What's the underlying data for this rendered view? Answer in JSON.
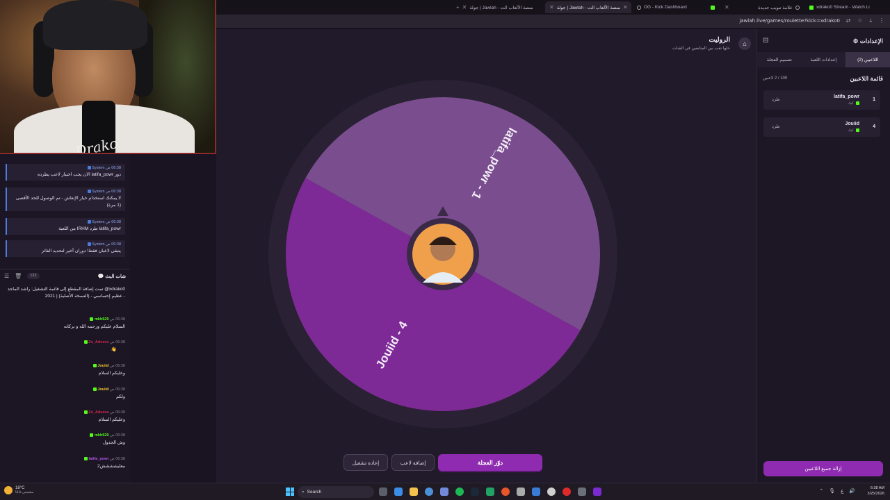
{
  "browser": {
    "tabs": [
      {
        "label": "xdrako0 Stream - Watch Li",
        "active": false
      },
      {
        "label": "علامة تبويب جديدة",
        "active": false
      },
      {
        "label": "OG - Kick Dashboard",
        "active": false
      },
      {
        "label": "جولة | Jawlah - منصة الألعاب الت",
        "active": true
      },
      {
        "label": "جولة | Jawlah - منصة الألعاب الت",
        "active": false
      }
    ],
    "url": "jawlah.live/games/roulette?kick=xdrako0"
  },
  "webcam": {
    "signature": "Drako"
  },
  "system_messages": [
    {
      "meta": "06:38 ص",
      "sender": "System",
      "text": "دور latifa_powr الان يجب اختيار لاعب يطرده"
    },
    {
      "meta": "06:38 ص",
      "sender": "System",
      "text": "لا يمكنك استخدام خيار الإنعاش - تم الوصول للحد الأقصى (1 مرة)"
    },
    {
      "meta": "06:38 ص",
      "sender": "System",
      "text": "latifa_powr طرد IRHM من اللعبة"
    },
    {
      "meta": "06:38 ص",
      "sender": "System",
      "text": "يتبقى لاعبان فقط! دوران أخير لتحديد الفائز"
    }
  ],
  "chat": {
    "title": "شات البث",
    "count": "122",
    "messages": [
      {
        "user": "",
        "time": "",
        "color": "#e6e0ee",
        "text": "xdrako0@ تمت إضافة المقطع إلى قائمة التشغيل: راشد الماجد - عظيم إحساسي - (النسخة الأصلية) | 2021"
      },
      {
        "user": "mkh620",
        "time": "06:38 ص",
        "color": "#53fc18",
        "text": "السلام عليكم ورحمه الله و بركاته"
      },
      {
        "user": "Zo_Adeeee",
        "time": "06:38 ص",
        "color": "#d0264f",
        "text": "👋"
      },
      {
        "user": "Jouiid",
        "time": "06:38 ص",
        "color": "#f0c92e",
        "text": "وعليكم السلام"
      },
      {
        "user": "Jouiid",
        "time": "06:38 ص",
        "color": "#f0c92e",
        "text": "ولكم"
      },
      {
        "user": "Zo_Adeeee",
        "time": "06:38 ص",
        "color": "#d0264f",
        "text": "وعليكم السلام"
      },
      {
        "user": "mkh620",
        "time": "06:38 ص",
        "color": "#53fc18",
        "text": "وش الجدول"
      },
      {
        "user": "latifa_powr",
        "time": "06:38 ص",
        "color": "#b054e8",
        "text": "معليشششش2"
      }
    ]
  },
  "main": {
    "title": "الروليت",
    "subtitle": "خلها تقب بين المتابعين في الشات",
    "buttons": {
      "spin": "دوّر العجلة",
      "add_player": "إضافة لاعب",
      "reset": "إعادة تشغيل"
    }
  },
  "chart_data": {
    "type": "pie",
    "title": "",
    "slices": [
      {
        "label": "latifa_powr - 1",
        "value": 50,
        "color": "#7a4e8e"
      },
      {
        "label": "Jouiid - 4",
        "value": 50,
        "color": "#7e2a96"
      }
    ]
  },
  "side": {
    "title": "الإعدادات",
    "tabs": [
      {
        "label": "اللاعبين (2)",
        "active": true
      },
      {
        "label": "إعدادات اللعبة",
        "active": false
      },
      {
        "label": "تصميم العجلة",
        "active": false
      }
    ],
    "players_title": "قائمة اللاعبين",
    "players_count": "100 / 2 لاعبين",
    "players": [
      {
        "num": "1",
        "name": "latifa_powr",
        "tag": "كيك",
        "action": "طرد"
      },
      {
        "num": "4",
        "name": "Jouiid",
        "tag": "كيك",
        "action": "طرد"
      }
    ],
    "clear_all": "إزالة جميع اللاعبين"
  },
  "taskbar": {
    "weather_temp": "18°C",
    "weather_desc": "مشمس غالبًا",
    "search": "Search",
    "time": "6:38 AM",
    "date": "3/25/2026",
    "lang": "ع"
  }
}
